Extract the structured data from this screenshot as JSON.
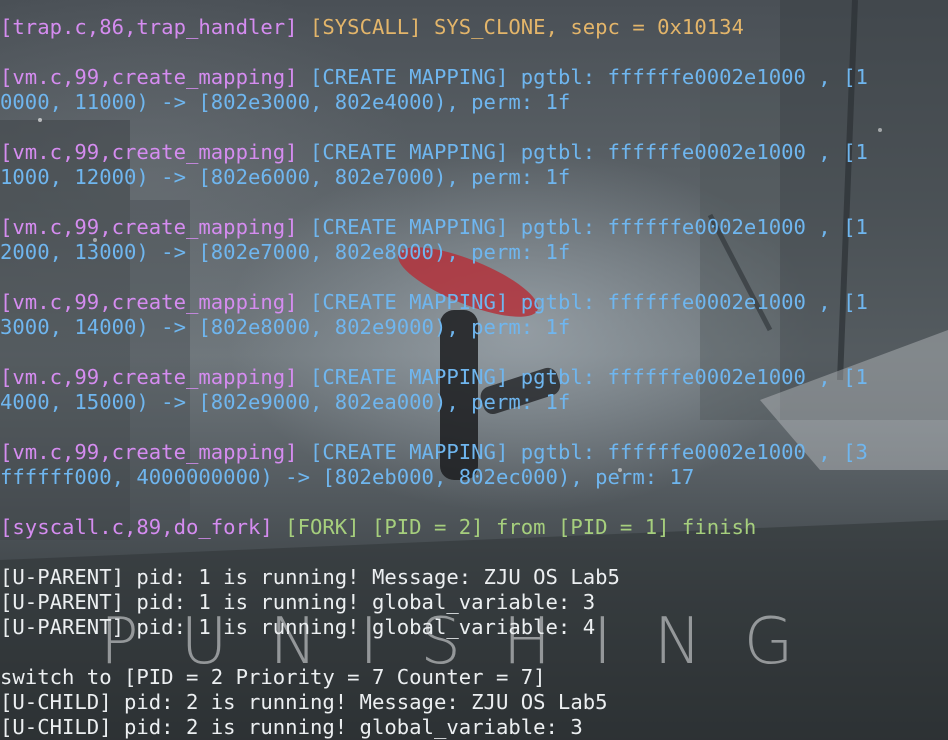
{
  "background": {
    "brand_text": "PUNISHING"
  },
  "terminal": {
    "lines": [
      {
        "segments": [
          {
            "text": "[trap.c,86,trap_handler] ",
            "color": "magenta"
          },
          {
            "text": "[SYSCALL] SYS_CLONE, sepc = 0x10134",
            "color": "yellow"
          }
        ]
      },
      {
        "blank": true
      },
      {
        "segments": [
          {
            "text": "[vm.c,99,create_mapping] ",
            "color": "magenta"
          },
          {
            "text": "[CREATE MAPPING] pgtbl: ffffffe0002e1000 , [1",
            "color": "blue"
          }
        ]
      },
      {
        "segments": [
          {
            "text": "0000, 11000) -> [802e3000, 802e4000), perm: 1f",
            "color": "blue"
          }
        ]
      },
      {
        "blank": true
      },
      {
        "segments": [
          {
            "text": "[vm.c,99,create_mapping] ",
            "color": "magenta"
          },
          {
            "text": "[CREATE MAPPING] pgtbl: ffffffe0002e1000 , [1",
            "color": "blue"
          }
        ]
      },
      {
        "segments": [
          {
            "text": "1000, 12000) -> [802e6000, 802e7000), perm: 1f",
            "color": "blue"
          }
        ]
      },
      {
        "blank": true
      },
      {
        "segments": [
          {
            "text": "[vm.c,99,create_mapping] ",
            "color": "magenta"
          },
          {
            "text": "[CREATE MAPPING] pgtbl: ffffffe0002e1000 , [1",
            "color": "blue"
          }
        ]
      },
      {
        "segments": [
          {
            "text": "2000, 13000) -> [802e7000, 802e8000), perm: 1f",
            "color": "blue"
          }
        ]
      },
      {
        "blank": true
      },
      {
        "segments": [
          {
            "text": "[vm.c,99,create_mapping] ",
            "color": "magenta"
          },
          {
            "text": "[CREATE MAPPING] pgtbl: ffffffe0002e1000 , [1",
            "color": "blue"
          }
        ]
      },
      {
        "segments": [
          {
            "text": "3000, 14000) -> [802e8000, 802e9000), perm: 1f",
            "color": "blue"
          }
        ]
      },
      {
        "blank": true
      },
      {
        "segments": [
          {
            "text": "[vm.c,99,create_mapping] ",
            "color": "magenta"
          },
          {
            "text": "[CREATE MAPPING] pgtbl: ffffffe0002e1000 , [1",
            "color": "blue"
          }
        ]
      },
      {
        "segments": [
          {
            "text": "4000, 15000) -> [802e9000, 802ea000), perm: 1f",
            "color": "blue"
          }
        ]
      },
      {
        "blank": true
      },
      {
        "segments": [
          {
            "text": "[vm.c,99,create_mapping] ",
            "color": "magenta"
          },
          {
            "text": "[CREATE MAPPING] pgtbl: ffffffe0002e1000 , [3",
            "color": "blue"
          }
        ]
      },
      {
        "segments": [
          {
            "text": "ffffff000, 4000000000) -> [802eb000, 802ec000), perm: 17",
            "color": "blue"
          }
        ]
      },
      {
        "blank": true
      },
      {
        "segments": [
          {
            "text": "[syscall.c,89,do_fork] ",
            "color": "magenta"
          },
          {
            "text": "[FORK] [PID = 2] from [PID = 1] finish",
            "color": "green"
          }
        ]
      },
      {
        "blank": true
      },
      {
        "segments": [
          {
            "text": "[U-PARENT] pid: 1 is running! Message: ZJU OS Lab5",
            "color": "white"
          }
        ]
      },
      {
        "segments": [
          {
            "text": "[U-PARENT] pid: 1 is running! global_variable: 3",
            "color": "white"
          }
        ]
      },
      {
        "segments": [
          {
            "text": "[U-PARENT] pid: 1 is running! global_variable: 4",
            "color": "white"
          }
        ]
      },
      {
        "blank": true
      },
      {
        "segments": [
          {
            "text": "switch to [PID = 2 Priority = 7 Counter = 7]",
            "color": "white"
          }
        ]
      },
      {
        "segments": [
          {
            "text": "[U-CHILD] pid: 2 is running! Message: ZJU OS Lab5",
            "color": "white"
          }
        ]
      },
      {
        "segments": [
          {
            "text": "[U-CHILD] pid: 2 is running! global_variable: 3",
            "color": "white"
          }
        ]
      }
    ]
  },
  "colors": {
    "magenta": "#d58cf0",
    "yellow": "#e3b56a",
    "blue": "#6fb6ef",
    "green": "#a6cf7d",
    "white": "#eceff1"
  }
}
